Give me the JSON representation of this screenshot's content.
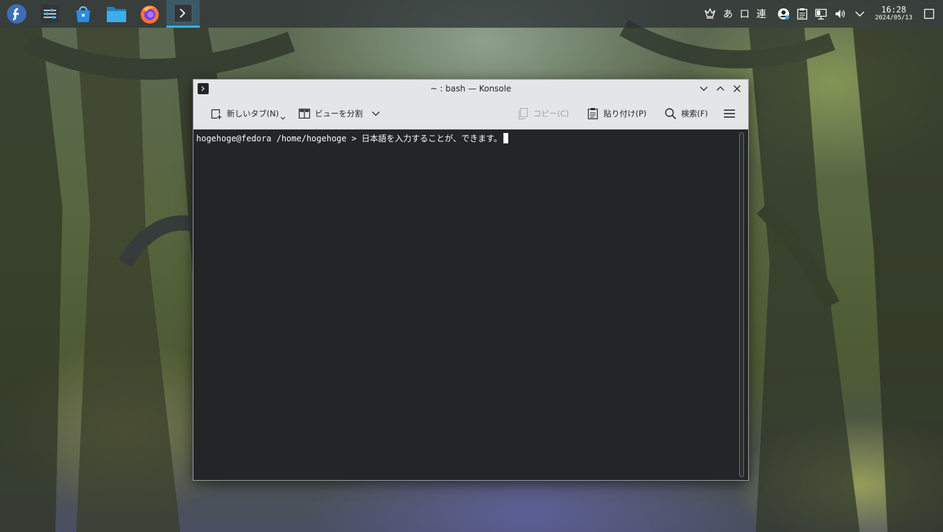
{
  "taskbar": {
    "launchers": [
      {
        "name": "fedora-launcher-icon"
      },
      {
        "name": "system-settings-icon"
      },
      {
        "name": "software-center-icon"
      },
      {
        "name": "file-manager-icon"
      },
      {
        "name": "firefox-icon"
      },
      {
        "name": "konsole-icon"
      }
    ],
    "tray": {
      "input_method_char": "あ",
      "square_char": "口",
      "ren_char": "連",
      "time": "16:28",
      "date": "2024/05/13"
    }
  },
  "window": {
    "title": "~ : bash — Konsole",
    "toolbar": {
      "new_tab": "新しいタブ(N)",
      "split_view": "ビューを分割",
      "copy": "コピー(C)",
      "paste": "貼り付け(P)",
      "search": "検索(F)"
    },
    "terminal": {
      "prompt": "hogehoge@fedora /home/hogehoge > ",
      "input": "日本語を入力することが、できます。"
    }
  },
  "colors": {
    "accent": "#3daee9",
    "terminal_bg": "#232627",
    "terminal_fg": "#fcfcfc",
    "toolbar_bg": "#e3e5e7"
  }
}
